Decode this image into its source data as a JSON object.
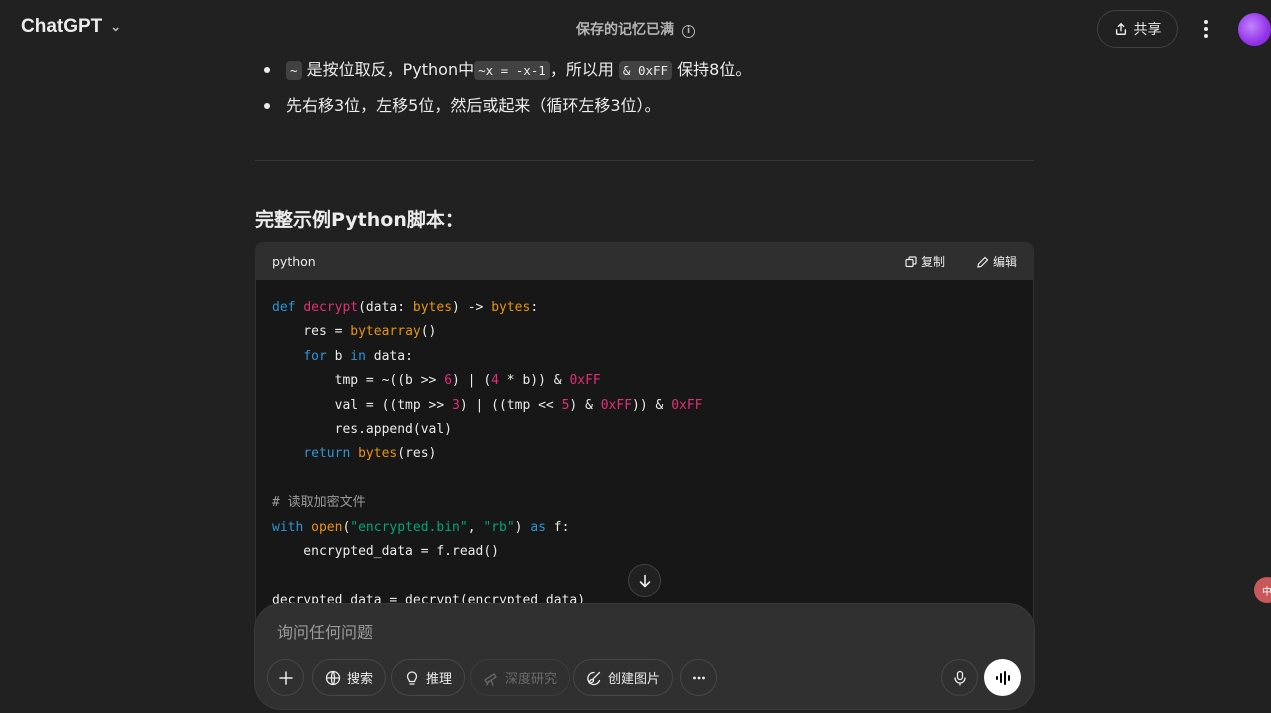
{
  "header": {
    "brand": "ChatGPT",
    "memory_notice": "保存的记忆已满",
    "share_label": "共享"
  },
  "content": {
    "bullet1_prefix_code": "~",
    "bullet1_text1": " 是按位取反，Python中",
    "bullet1_code2": "~x = -x-1",
    "bullet1_text2": "，所以用 ",
    "bullet1_code3": "& 0xFF",
    "bullet1_text3": " 保持8位。",
    "bullet2_text": "先右移3位，左移5位，然后或起来（循环左移3位）。",
    "section_title": "完整示例Python脚本：",
    "code_language": "python",
    "copy_label": "复制",
    "edit_label": "编辑"
  },
  "composer": {
    "placeholder": "询问任何问题",
    "search_label": "搜索",
    "reason_label": "推理",
    "deep_research_label": "深度研究",
    "create_image_label": "创建图片"
  },
  "side_badge": "中"
}
